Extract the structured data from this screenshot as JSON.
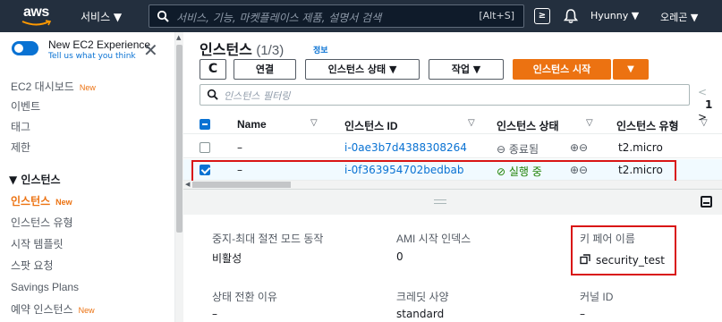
{
  "topnav": {
    "logo": "aws",
    "services": "서비스 ▼",
    "search_placeholder": "서비스, 기능, 마켓플레이스 제품, 설명서 검색",
    "search_shortcut": "[Alt+S]",
    "cloudshell_glyph": "≥",
    "bell_icon": "bell-icon",
    "user": "Hyunny ▼",
    "region": "오레곤 ▼"
  },
  "sidebar": {
    "new_experience": "New EC2 Experience",
    "tell_us": "Tell us what you think",
    "close": "✕",
    "items": [
      {
        "label": "EC2 대시보드",
        "badge": "New"
      },
      {
        "label": "이벤트",
        "badge": ""
      },
      {
        "label": "태그",
        "badge": ""
      },
      {
        "label": "제한",
        "badge": ""
      }
    ],
    "section_label": "▼ 인스턴스",
    "sub_items": [
      {
        "label": "인스턴스",
        "badge": "New"
      },
      {
        "label": "인스턴스 유형",
        "badge": ""
      },
      {
        "label": "시작 템플릿",
        "badge": ""
      },
      {
        "label": "스팟 요청",
        "badge": ""
      },
      {
        "label": "Savings Plans",
        "badge": ""
      },
      {
        "label": "예약 인스턴스",
        "badge": "New"
      }
    ]
  },
  "main": {
    "title": "인스턴스",
    "count": "(1/3)",
    "info": "정보",
    "buttons": {
      "refresh": "C",
      "connect": "연결",
      "instance_state": "인스턴스 상태 ▼",
      "actions": "작업 ▼",
      "launch": "인스턴스 시작",
      "launch_dropdown": "▼"
    },
    "filter_placeholder": "인스턴스 필터링",
    "pager": {
      "prev": "<",
      "page": "1",
      "next": ">"
    },
    "columns": [
      "Name",
      "인스턴스 ID",
      "인스턴스 상태",
      "인스턴스 유형"
    ],
    "rows": [
      {
        "selected": false,
        "name": "–",
        "id": "i-0ae3b7d4388308264",
        "state": "종료됨",
        "state_icon": "⊖",
        "zoom": "⊕⊖",
        "type": "t2.micro"
      },
      {
        "selected": true,
        "name": "–",
        "id": "i-0f363954702bedbab",
        "state": "실행 중",
        "state_icon": "⊘",
        "zoom": "⊕⊖",
        "type": "t2.micro"
      }
    ]
  },
  "detail": {
    "fields": [
      {
        "label": "중지-최대 절전 모드 동작",
        "value": "비활성"
      },
      {
        "label": "AMI 시작 인덱스",
        "value": "0"
      },
      {
        "label": "키 페어 이름",
        "value": "security_test"
      },
      {
        "label": "상태 전환 이유",
        "value": "–"
      },
      {
        "label": "크레딧 사양",
        "value": "standard"
      },
      {
        "label": "커널 ID",
        "value": "–"
      }
    ]
  },
  "colors": {
    "nav_bg": "#232f3e",
    "accent": "#ec7211",
    "link": "#0972d3",
    "success": "#1d8102",
    "highlight": "#d91515"
  }
}
